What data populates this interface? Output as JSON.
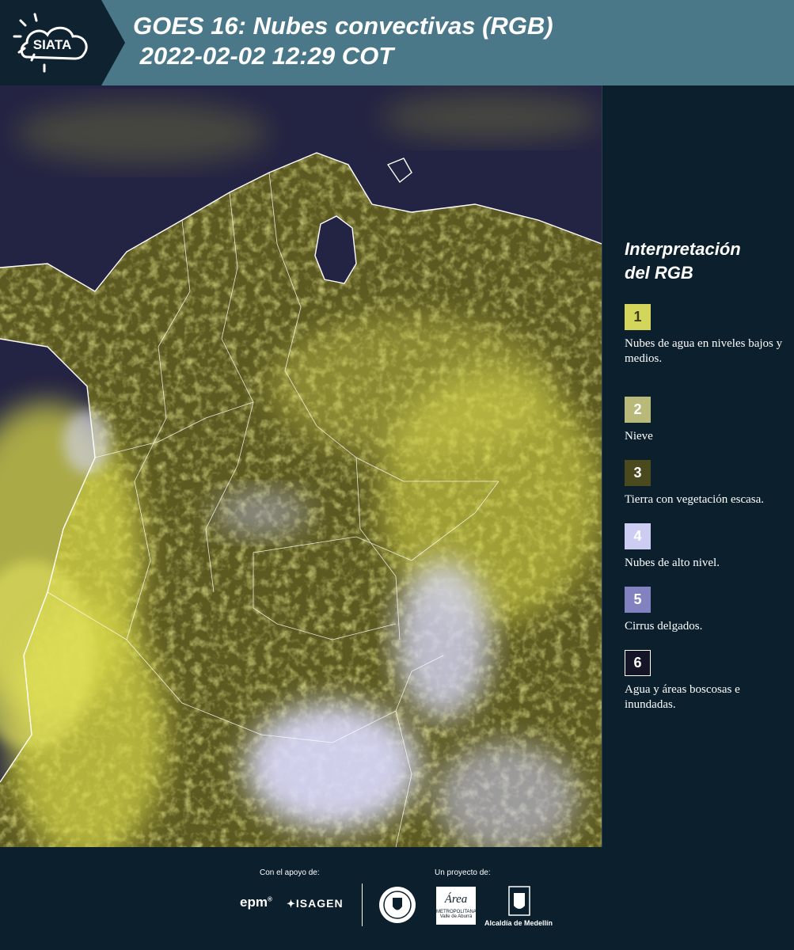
{
  "header": {
    "logo_text": "SIATA",
    "title_line1": "GOES 16: Nubes convectivas (RGB)",
    "title_line2": " 2022-02-02 12:29 COT"
  },
  "map": {
    "image": "goes16-convective-clouds-rgb-colombia",
    "colors": {
      "water": "#232343",
      "land": "#5c5a20",
      "low_clouds": "#d8d84a",
      "high_clouds": "#dcdcff",
      "borders": "#ffffff"
    }
  },
  "legend": {
    "title_line1": "Interpretación",
    "title_line2": "del RGB",
    "items": [
      {
        "number": "1",
        "label": "Nubes de agua en niveles bajos y medios.",
        "color": "#d4d65c",
        "text_color": "#3a3a1a"
      },
      {
        "number": "2",
        "label": "Nieve",
        "color": "#b9b97a",
        "text_color": "#ffffff"
      },
      {
        "number": "3",
        "label": "Tierra con vegetación escasa.",
        "color": "#4a4a1e",
        "text_color": "#ffffff"
      },
      {
        "number": "4",
        "label": "Nubes de alto nivel.",
        "color": "#cdcdf3",
        "text_color": "#ffffff"
      },
      {
        "number": "5",
        "label": "Cirrus delgados.",
        "color": "#8282c0",
        "text_color": "#ffffff"
      },
      {
        "number": "6",
        "label": "Agua y áreas boscosas e inundadas.",
        "color": "#151528",
        "text_color": "#ffffff",
        "border": "#ffffff"
      }
    ]
  },
  "footer": {
    "support_label": "Con el apoyo de:",
    "project_label": "Un proyecto de:",
    "sponsors": {
      "epm": "epm",
      "isagen": "ISAGEN",
      "area_metro": "Área",
      "area_metro_sub1": "METROPOLITANA",
      "area_metro_sub2": "Valle de Aburrá",
      "alcaldia": "Alcaldía de Medellín"
    }
  }
}
